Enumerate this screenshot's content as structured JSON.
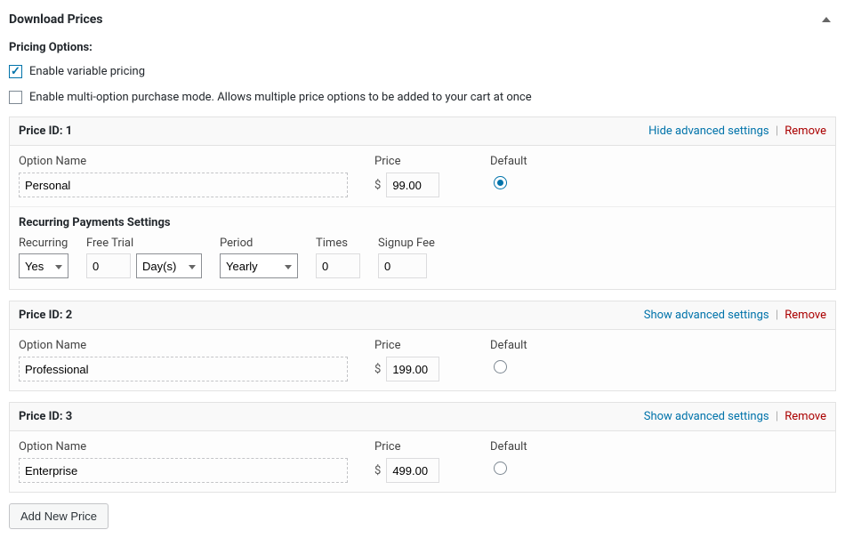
{
  "panel": {
    "title": "Download Prices",
    "pricing_options_label": "Pricing Options:",
    "enable_variable_label": "Enable variable pricing",
    "enable_variable_checked": true,
    "enable_multi_label": "Enable multi-option purchase mode. Allows multiple price options to be added to your cart at once",
    "enable_multi_checked": false,
    "add_new_price_label": "Add New Price"
  },
  "labels": {
    "price_id_prefix": "Price ID:",
    "option_name": "Option Name",
    "price": "Price",
    "default": "Default",
    "currency": "$",
    "hide_adv": "Hide advanced settings",
    "show_adv": "Show advanced settings",
    "remove": "Remove",
    "sep": "|",
    "recurring_settings": "Recurring Payments Settings",
    "recurring": "Recurring",
    "free_trial": "Free Trial",
    "period": "Period",
    "times": "Times",
    "signup_fee": "Signup Fee"
  },
  "prices": [
    {
      "id": "1",
      "name": "Personal",
      "price": "99.00",
      "default": true,
      "advanced_open": true,
      "recurring": {
        "recurring": "Yes",
        "trial_qty": "0",
        "trial_unit": "Day(s)",
        "period": "Yearly",
        "times": "0",
        "signup_fee": "0"
      }
    },
    {
      "id": "2",
      "name": "Professional",
      "price": "199.00",
      "default": false,
      "advanced_open": false
    },
    {
      "id": "3",
      "name": "Enterprise",
      "price": "499.00",
      "default": false,
      "advanced_open": false
    }
  ]
}
